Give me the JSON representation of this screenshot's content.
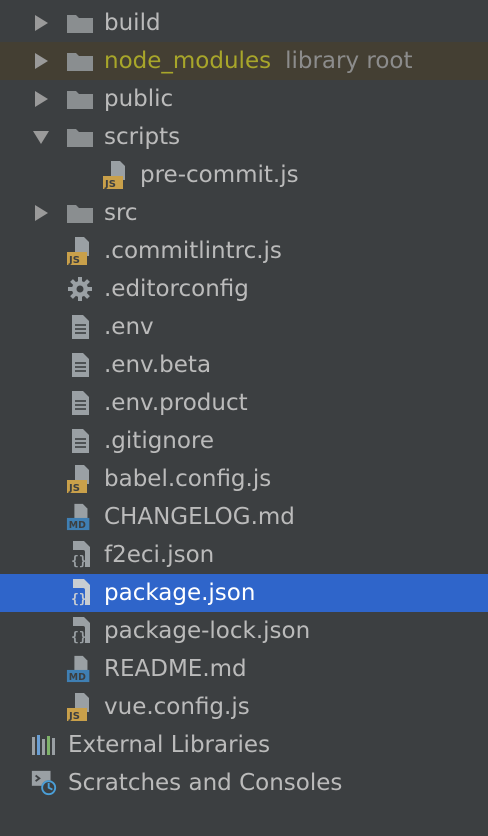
{
  "tree": {
    "items": [
      {
        "label": "build",
        "icon": "folder-icon",
        "expandable": true,
        "expanded": false
      },
      {
        "label": "node_modules",
        "suffix": "library root",
        "icon": "folder-icon",
        "expandable": true,
        "expanded": false,
        "label_color": "#a8a62a"
      },
      {
        "label": "public",
        "icon": "folder-icon",
        "expandable": true,
        "expanded": false
      },
      {
        "label": "scripts",
        "icon": "folder-icon",
        "expandable": true,
        "expanded": true
      },
      {
        "label": "pre-commit.js",
        "icon": "js-file-icon",
        "child_of": "scripts"
      },
      {
        "label": "src",
        "icon": "folder-icon",
        "expandable": true,
        "expanded": false
      },
      {
        "label": ".commitlintrc.js",
        "icon": "js-file-icon"
      },
      {
        "label": ".editorconfig",
        "icon": "gear-icon"
      },
      {
        "label": ".env",
        "icon": "text-file-icon"
      },
      {
        "label": ".env.beta",
        "icon": "text-file-icon"
      },
      {
        "label": ".env.product",
        "icon": "text-file-icon"
      },
      {
        "label": ".gitignore",
        "icon": "text-file-icon"
      },
      {
        "label": "babel.config.js",
        "icon": "js-file-icon"
      },
      {
        "label": "CHANGELOG.md",
        "icon": "md-file-icon"
      },
      {
        "label": "f2eci.json",
        "icon": "json-file-icon"
      },
      {
        "label": "package.json",
        "icon": "json-file-icon",
        "selected": true
      },
      {
        "label": "package-lock.json",
        "icon": "json-file-icon"
      },
      {
        "label": "README.md",
        "icon": "md-file-icon"
      },
      {
        "label": "vue.config.js",
        "icon": "js-file-icon"
      }
    ],
    "external_libraries": {
      "label": "External Libraries",
      "icon": "library-icon"
    },
    "scratches": {
      "label": "Scratches and Consoles",
      "icon": "scratches-icon"
    }
  },
  "icon_badges": {
    "js": "JS",
    "md": "MD"
  },
  "colors": {
    "background": "#3c3f41",
    "text": "#bbbbbb",
    "selected_bg": "#2f65ca",
    "highlight_bg": "#443f33",
    "library_root_text": "#a8a62a",
    "folder": "#8a8e90",
    "js_badge": "#c9a04a",
    "md_badge": "#3f7fb3"
  }
}
